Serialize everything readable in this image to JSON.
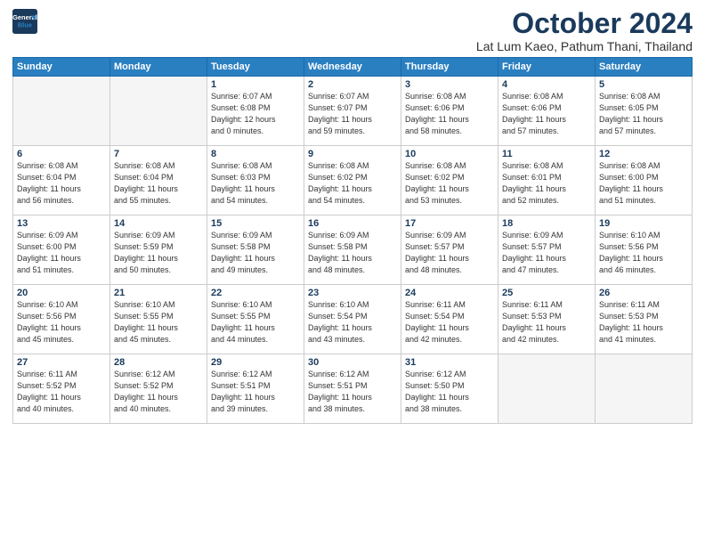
{
  "header": {
    "logo_line1": "General",
    "logo_line2": "Blue",
    "month": "October 2024",
    "location": "Lat Lum Kaeo, Pathum Thani, Thailand"
  },
  "weekdays": [
    "Sunday",
    "Monday",
    "Tuesday",
    "Wednesday",
    "Thursday",
    "Friday",
    "Saturday"
  ],
  "weeks": [
    [
      {
        "day": "",
        "info": ""
      },
      {
        "day": "",
        "info": ""
      },
      {
        "day": "1",
        "info": "Sunrise: 6:07 AM\nSunset: 6:08 PM\nDaylight: 12 hours\nand 0 minutes."
      },
      {
        "day": "2",
        "info": "Sunrise: 6:07 AM\nSunset: 6:07 PM\nDaylight: 11 hours\nand 59 minutes."
      },
      {
        "day": "3",
        "info": "Sunrise: 6:08 AM\nSunset: 6:06 PM\nDaylight: 11 hours\nand 58 minutes."
      },
      {
        "day": "4",
        "info": "Sunrise: 6:08 AM\nSunset: 6:06 PM\nDaylight: 11 hours\nand 57 minutes."
      },
      {
        "day": "5",
        "info": "Sunrise: 6:08 AM\nSunset: 6:05 PM\nDaylight: 11 hours\nand 57 minutes."
      }
    ],
    [
      {
        "day": "6",
        "info": "Sunrise: 6:08 AM\nSunset: 6:04 PM\nDaylight: 11 hours\nand 56 minutes."
      },
      {
        "day": "7",
        "info": "Sunrise: 6:08 AM\nSunset: 6:04 PM\nDaylight: 11 hours\nand 55 minutes."
      },
      {
        "day": "8",
        "info": "Sunrise: 6:08 AM\nSunset: 6:03 PM\nDaylight: 11 hours\nand 54 minutes."
      },
      {
        "day": "9",
        "info": "Sunrise: 6:08 AM\nSunset: 6:02 PM\nDaylight: 11 hours\nand 54 minutes."
      },
      {
        "day": "10",
        "info": "Sunrise: 6:08 AM\nSunset: 6:02 PM\nDaylight: 11 hours\nand 53 minutes."
      },
      {
        "day": "11",
        "info": "Sunrise: 6:08 AM\nSunset: 6:01 PM\nDaylight: 11 hours\nand 52 minutes."
      },
      {
        "day": "12",
        "info": "Sunrise: 6:08 AM\nSunset: 6:00 PM\nDaylight: 11 hours\nand 51 minutes."
      }
    ],
    [
      {
        "day": "13",
        "info": "Sunrise: 6:09 AM\nSunset: 6:00 PM\nDaylight: 11 hours\nand 51 minutes."
      },
      {
        "day": "14",
        "info": "Sunrise: 6:09 AM\nSunset: 5:59 PM\nDaylight: 11 hours\nand 50 minutes."
      },
      {
        "day": "15",
        "info": "Sunrise: 6:09 AM\nSunset: 5:58 PM\nDaylight: 11 hours\nand 49 minutes."
      },
      {
        "day": "16",
        "info": "Sunrise: 6:09 AM\nSunset: 5:58 PM\nDaylight: 11 hours\nand 48 minutes."
      },
      {
        "day": "17",
        "info": "Sunrise: 6:09 AM\nSunset: 5:57 PM\nDaylight: 11 hours\nand 48 minutes."
      },
      {
        "day": "18",
        "info": "Sunrise: 6:09 AM\nSunset: 5:57 PM\nDaylight: 11 hours\nand 47 minutes."
      },
      {
        "day": "19",
        "info": "Sunrise: 6:10 AM\nSunset: 5:56 PM\nDaylight: 11 hours\nand 46 minutes."
      }
    ],
    [
      {
        "day": "20",
        "info": "Sunrise: 6:10 AM\nSunset: 5:56 PM\nDaylight: 11 hours\nand 45 minutes."
      },
      {
        "day": "21",
        "info": "Sunrise: 6:10 AM\nSunset: 5:55 PM\nDaylight: 11 hours\nand 45 minutes."
      },
      {
        "day": "22",
        "info": "Sunrise: 6:10 AM\nSunset: 5:55 PM\nDaylight: 11 hours\nand 44 minutes."
      },
      {
        "day": "23",
        "info": "Sunrise: 6:10 AM\nSunset: 5:54 PM\nDaylight: 11 hours\nand 43 minutes."
      },
      {
        "day": "24",
        "info": "Sunrise: 6:11 AM\nSunset: 5:54 PM\nDaylight: 11 hours\nand 42 minutes."
      },
      {
        "day": "25",
        "info": "Sunrise: 6:11 AM\nSunset: 5:53 PM\nDaylight: 11 hours\nand 42 minutes."
      },
      {
        "day": "26",
        "info": "Sunrise: 6:11 AM\nSunset: 5:53 PM\nDaylight: 11 hours\nand 41 minutes."
      }
    ],
    [
      {
        "day": "27",
        "info": "Sunrise: 6:11 AM\nSunset: 5:52 PM\nDaylight: 11 hours\nand 40 minutes."
      },
      {
        "day": "28",
        "info": "Sunrise: 6:12 AM\nSunset: 5:52 PM\nDaylight: 11 hours\nand 40 minutes."
      },
      {
        "day": "29",
        "info": "Sunrise: 6:12 AM\nSunset: 5:51 PM\nDaylight: 11 hours\nand 39 minutes."
      },
      {
        "day": "30",
        "info": "Sunrise: 6:12 AM\nSunset: 5:51 PM\nDaylight: 11 hours\nand 38 minutes."
      },
      {
        "day": "31",
        "info": "Sunrise: 6:12 AM\nSunset: 5:50 PM\nDaylight: 11 hours\nand 38 minutes."
      },
      {
        "day": "",
        "info": ""
      },
      {
        "day": "",
        "info": ""
      }
    ]
  ]
}
